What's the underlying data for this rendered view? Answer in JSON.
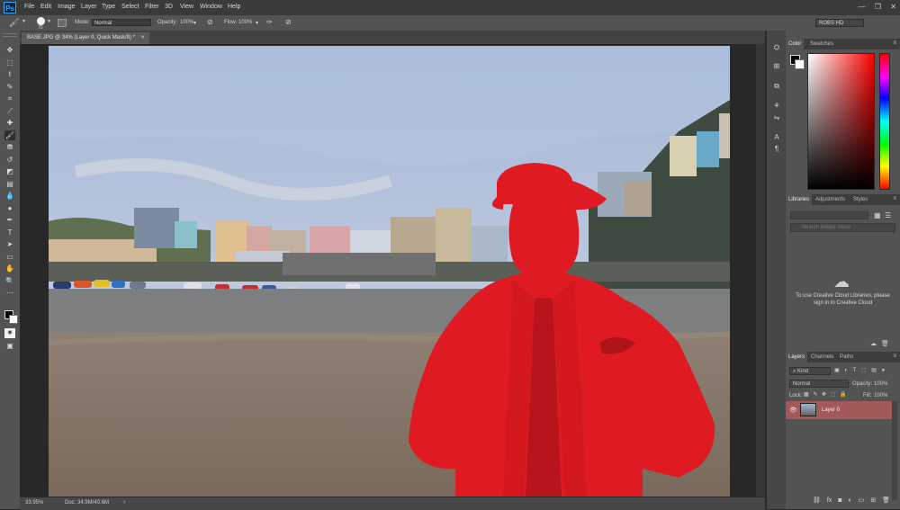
{
  "app": {
    "logo": "Ps"
  },
  "menu": [
    "File",
    "Edit",
    "Image",
    "Layer",
    "Type",
    "Select",
    "Filter",
    "3D",
    "View",
    "Window",
    "Help"
  ],
  "window_controls": [
    "—",
    "❐",
    "✕"
  ],
  "options": {
    "brush_size": "70",
    "mode_label": "Mode:",
    "mode_value": "Normal",
    "opacity_label": "Opacity:",
    "opacity_value": "100%",
    "flow_label": "Flow:",
    "flow_value": "100%",
    "workspace": "ROBS HD"
  },
  "document": {
    "tab_title": "BASE.JPG @ 34% (Layer 0, Quick Mask/8) *",
    "tab_close": "×"
  },
  "status": {
    "zoom": "33.95%",
    "doc_size": "Doc: 34.9M/40.6M",
    "arrow": "›"
  },
  "panels": {
    "color_tabs": [
      "Color",
      "Swatches"
    ],
    "library_tabs": [
      "Libraries",
      "Adjustments",
      "Styles"
    ],
    "library_search_placeholder": "Search Adobe Stock",
    "library_message": "To use Creative Cloud Libraries, please sign in to Creative Cloud",
    "layers_tabs": [
      "Layers",
      "Channels",
      "Paths"
    ],
    "layers_filter": "Kind",
    "blend_mode": "Normal",
    "opacity_label": "Opacity:",
    "opacity_value": "100%",
    "lock_label": "Lock:",
    "fill_label": "Fill:",
    "fill_value": "100%",
    "layer_name": "Layer 0"
  },
  "colors": {
    "quick_mask": "#e01a22",
    "layer_highlight": "#a3585a",
    "panel_bg": "#535353",
    "app_bg": "#282828"
  }
}
